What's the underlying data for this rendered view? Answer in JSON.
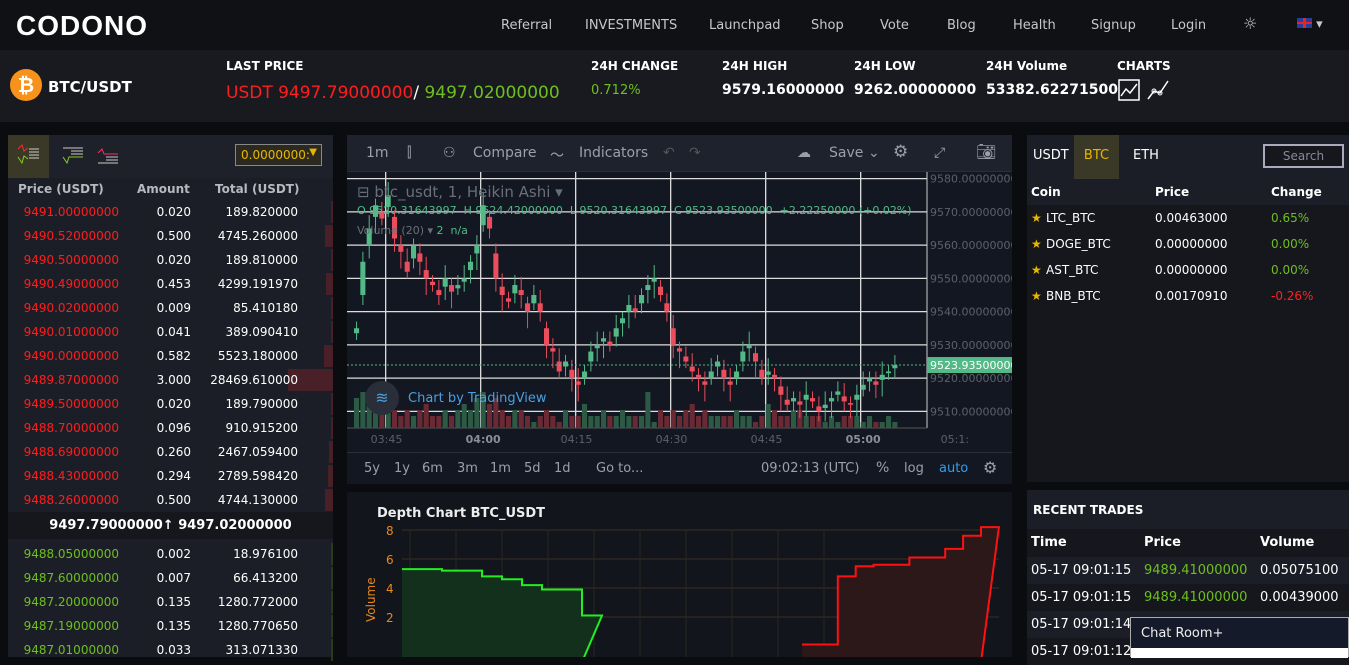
{
  "nav": {
    "logo": "CODONO",
    "items": [
      "Referral",
      "INVESTMENTS",
      "Launchpad",
      "Shop",
      "Vote",
      "Blog",
      "Health",
      "Signup",
      "Login"
    ],
    "theme_icon": "sun-icon",
    "lang_icon": "uk-flag-icon"
  },
  "ticker": {
    "pair": "BTC/USDT",
    "coin_icon": "bitcoin-icon",
    "last_price_label": "LAST PRICE",
    "last_price": "USDT 9497.79000000",
    "sep": "/",
    "last_price_alt": "9497.02000000",
    "change_label": "24H CHANGE",
    "change": "0.712%",
    "high_label": "24H HIGH",
    "high": "9579.16000000",
    "low_label": "24H LOW",
    "low": "9262.00000000",
    "volume_label": "24H Volume",
    "volume": "53382.62271500",
    "charts_label": "CHARTS"
  },
  "orderbook": {
    "precision": "0.0000000:",
    "headers": [
      "Price (USDT)",
      "Amount",
      "Total (USDT)"
    ],
    "asks": [
      [
        "9491.00000000",
        "0.020",
        "189.820000"
      ],
      [
        "9490.52000000",
        "0.500",
        "4745.260000"
      ],
      [
        "9490.50000000",
        "0.020",
        "189.810000"
      ],
      [
        "9490.49000000",
        "0.453",
        "4299.191970"
      ],
      [
        "9490.02000000",
        "0.009",
        "85.410180"
      ],
      [
        "9490.01000000",
        "0.041",
        "389.090410"
      ],
      [
        "9490.00000000",
        "0.582",
        "5523.180000"
      ],
      [
        "9489.87000000",
        "3.000",
        "28469.610000"
      ],
      [
        "9489.50000000",
        "0.020",
        "189.790000"
      ],
      [
        "9488.70000000",
        "0.096",
        "910.915200"
      ],
      [
        "9488.69000000",
        "0.260",
        "2467.059400"
      ],
      [
        "9488.43000000",
        "0.294",
        "2789.598420"
      ],
      [
        "9488.26000000",
        "0.500",
        "4744.130000"
      ]
    ],
    "mid": "9497.79000000↑ 9497.02000000",
    "bids": [
      [
        "9488.05000000",
        "0.002",
        "18.976100"
      ],
      [
        "9487.60000000",
        "0.007",
        "66.413200"
      ],
      [
        "9487.20000000",
        "0.135",
        "1280.772000"
      ],
      [
        "9487.19000000",
        "0.135",
        "1280.770650"
      ],
      [
        "9487.01000000",
        "0.033",
        "313.071330"
      ]
    ]
  },
  "chart": {
    "toolbar": {
      "interval": "1m",
      "compare": "Compare",
      "indicators": "Indicators",
      "save": "Save"
    },
    "legend_title": "btc_usdt, 1, Heikin Ashi",
    "ohlc": "O 9520.31643997  H 9524.42000000  L 9520.31643997  C 9523.93500000  +2.22250000 (+0.02%)",
    "volume_legend": "Volume (20)",
    "volume_val": "2  n/a",
    "watermark": "Chart by TradingView",
    "price_ticks": [
      "9580.00000000",
      "9570.00000000",
      "9560.00000000",
      "9550.00000000",
      "9540.00000000",
      "9530.00000000",
      "9520.00000000",
      "9510.00000000"
    ],
    "last_label": "9523.93500000",
    "time_ticks": [
      "03:45",
      "04:00",
      "04:15",
      "04:30",
      "04:45",
      "05:00",
      "05:1:"
    ],
    "ranges": [
      "5y",
      "1y",
      "6m",
      "3m",
      "1m",
      "5d",
      "1d"
    ],
    "goto": "Go to...",
    "clock": "09:02:13 (UTC)",
    "pct": "%",
    "log": "log",
    "auto": "auto"
  },
  "chart_data": [
    {
      "type": "candlestick",
      "start": "03:40",
      "interval": "1m",
      "ylim": [
        9505,
        9582
      ],
      "closes": [
        9535,
        9555,
        9565,
        9572,
        9568,
        9575,
        9562,
        9558,
        9552,
        9560,
        9555,
        9550,
        9548,
        9545,
        9550,
        9546,
        9548,
        9550,
        9555,
        9560,
        9572,
        9565,
        9550,
        9545,
        9543,
        9548,
        9545,
        9540,
        9545,
        9540,
        9530,
        9528,
        9522,
        9525,
        9520,
        9518,
        9522,
        9528,
        9530,
        9532,
        9530,
        9535,
        9538,
        9542,
        9540,
        9545,
        9548,
        9550,
        9545,
        9540,
        9530,
        9528,
        9525,
        9522,
        9520,
        9518,
        9522,
        9525,
        9520,
        9518,
        9522,
        9528,
        9530,
        9525,
        9520,
        9522,
        9520,
        9515,
        9512,
        9514,
        9512,
        9515,
        9513,
        9510,
        9512,
        9514,
        9516,
        9513,
        9512,
        9515,
        9518,
        9520,
        9518,
        9521,
        9522,
        9523.94
      ],
      "volumes": [
        5,
        6,
        4,
        3,
        4,
        6,
        3,
        2,
        3,
        2,
        3,
        4,
        2,
        2,
        3,
        2,
        3,
        4,
        3,
        5,
        6,
        4,
        5,
        3,
        2,
        3,
        3,
        2,
        1,
        2,
        3,
        2,
        1,
        3,
        2,
        2,
        4,
        2,
        2,
        3,
        2,
        2,
        3,
        2,
        2,
        2,
        6,
        1,
        3,
        2,
        3,
        2,
        3,
        4,
        2,
        3,
        2,
        2,
        2,
        2,
        3,
        2,
        2,
        1,
        2,
        4,
        3,
        2,
        2,
        3,
        3,
        2,
        2,
        2,
        1,
        2,
        1,
        2,
        2,
        2,
        1,
        2,
        1,
        1,
        2,
        1
      ]
    },
    {
      "type": "step-area",
      "title": "Depth Chart BTC_USDT",
      "ylabel": "Volume",
      "yticks": [
        "8",
        "6",
        "4",
        "2"
      ],
      "ylim": [
        0,
        8
      ],
      "bids": [
        5.3,
        5.3,
        5.2,
        5.2,
        4.8,
        4.6,
        4.2,
        3.9,
        3.9,
        2.1
      ],
      "asks": [
        0.1,
        0.1,
        4.8,
        5.5,
        5.6,
        5.6,
        6.1,
        6.1,
        6.7,
        7.6,
        8.2
      ]
    }
  ],
  "market": {
    "tabs": [
      "USDT",
      "BTC",
      "ETH"
    ],
    "search": "Search",
    "headers": [
      "Coin",
      "Price",
      "Change"
    ],
    "rows": [
      [
        "LTC_BTC",
        "0.00463000",
        "0.65%"
      ],
      [
        "DOGE_BTC",
        "0.00000000",
        "0.00%"
      ],
      [
        "AST_BTC",
        "0.00000000",
        "0.00%"
      ],
      [
        "BNB_BTC",
        "0.00170910",
        "-0.26%"
      ]
    ],
    "up": "#6fbf1e",
    "down": "#ff2020"
  },
  "trades": {
    "title": "RECENT TRADES",
    "headers": [
      "Time",
      "Price",
      "Volume"
    ],
    "rows": [
      [
        "05-17 09:01:15",
        "9489.41000000",
        "0.05075100"
      ],
      [
        "05-17 09:01:15",
        "9489.41000000",
        "0.00439000"
      ],
      [
        "05-17 09:01:14",
        "",
        ""
      ],
      [
        "05-17 09:01:12",
        "",
        ""
      ]
    ]
  },
  "chat": {
    "title": "Chat Room+"
  }
}
